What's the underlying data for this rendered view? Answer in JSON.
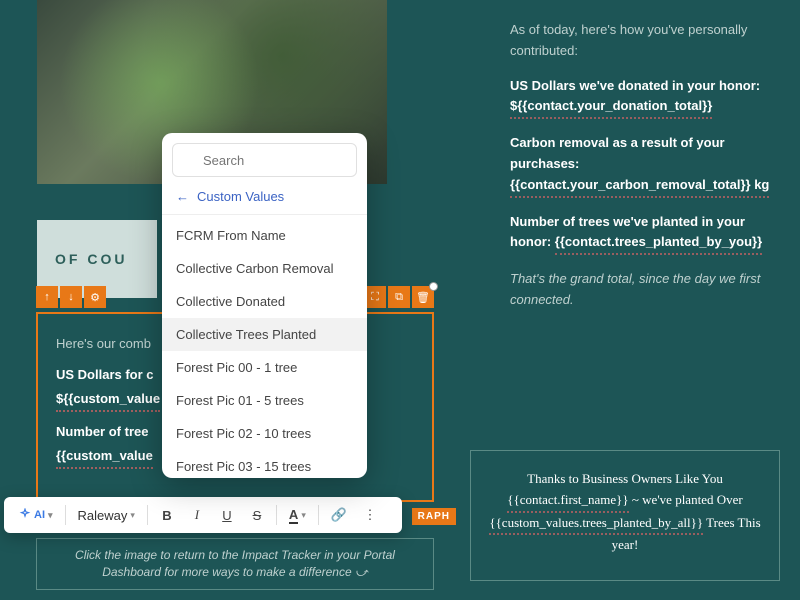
{
  "hero": {
    "alt": "Person holding a fern leaf"
  },
  "header": {
    "text": "OF COU"
  },
  "editor": {
    "line1": "Here's our comb",
    "line2_bold": "US Dollars for c",
    "line3_bold": "${{custom_value",
    "line4_bold": "Number of tree",
    "line5_bold": "{{custom_value"
  },
  "toolbar": {
    "ai_label": "AI",
    "font_label": "Raleway",
    "bold": "B",
    "italic": "I",
    "underline": "U",
    "strike": "S"
  },
  "graph_tab": "RAPH",
  "caption": "Click the image to return to the Impact Tracker in your Portal Dashboard for more ways to make a difference ⤻",
  "right": {
    "intro": "As of today, here's how you've personally contributed:",
    "dollars_label": "US Dollars we've donated in your honor:",
    "dollars_value": "${{contact.your_donation_total}}",
    "carbon_label": "Carbon removal as a result of your purchases:",
    "carbon_value": "{{contact.your_carbon_removal_total}} kg",
    "trees_label": "Number of trees we've planted in your honor:",
    "trees_value": "{{contact.trees_planted_by_you}}",
    "grand_total": "That's the grand total, since the day we first connected."
  },
  "thanks": {
    "line1": "Thanks to Business Owners Like You",
    "line2a": "{{contact.first_name}}",
    "line2b": " ~ we've planted Over",
    "line3a": "{{custom_values.trees_planted_by_all}}",
    "line3b": " Trees This year!"
  },
  "dropdown": {
    "search_placeholder": "Search",
    "back_label": "Custom Values",
    "items": [
      "FCRM From Name",
      "Collective Carbon Removal",
      "Collective Donated",
      "Collective Trees Planted",
      "Forest Pic 00 - 1 tree",
      "Forest Pic 01 - 5 trees",
      "Forest Pic 02 - 10 trees",
      "Forest Pic 03 - 15 trees"
    ],
    "hovered_index": 3
  }
}
